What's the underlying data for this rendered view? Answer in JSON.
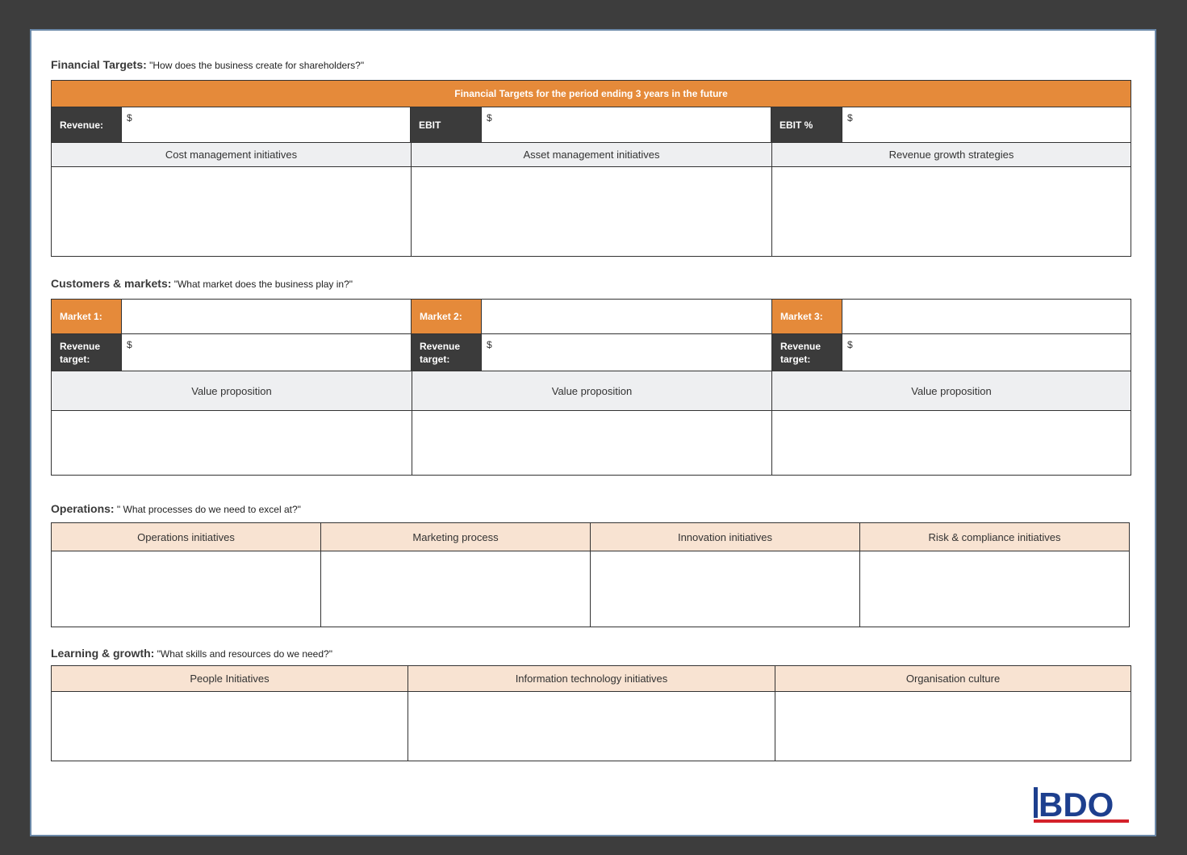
{
  "financial": {
    "title_bold": "Financial Targets:",
    "title_rest": " \"How does the business create for shareholders?\"",
    "header": "Financial Targets for the period ending 3 years in the future",
    "revenue_label": "Revenue:",
    "revenue_value": "$",
    "ebit_label": "EBIT",
    "ebit_value": "$",
    "ebit_pct_label": "EBIT %",
    "ebit_pct_value": "$",
    "columns": [
      "Cost management initiatives",
      "Asset management initiatives",
      "Revenue growth strategies"
    ]
  },
  "customers": {
    "title_bold": "Customers & markets:",
    "title_rest": " \"What market does the business play in?\"",
    "markets": [
      {
        "label": "Market 1:",
        "revenue_label": "Revenue target:",
        "revenue_value": "$",
        "value_prop": "Value proposition"
      },
      {
        "label": "Market 2:",
        "revenue_label": "Revenue target:",
        "revenue_value": "$",
        "value_prop": "Value proposition"
      },
      {
        "label": "Market 3:",
        "revenue_label": "Revenue target:",
        "revenue_value": "$",
        "value_prop": "Value proposition"
      }
    ]
  },
  "operations": {
    "title_bold": "Operations:",
    "title_rest": " \" What processes do we need to excel at?\"",
    "columns": [
      "Operations initiatives",
      "Marketing process",
      "Innovation initiatives",
      "Risk & compliance initiatives"
    ]
  },
  "learning": {
    "title_bold": "Learning & growth:",
    "title_rest": " \"What skills and resources do we need?\"",
    "columns": [
      "People Initiatives",
      "Information technology initiatives",
      "Organisation culture"
    ]
  },
  "logo": {
    "text": "BDO",
    "blue": "#1d3f8e",
    "red": "#d4212a"
  },
  "colors": {
    "orange": "#e58a3a",
    "dark": "#3b3b3b",
    "peach": "#f8e3d2",
    "grey": "#eeeff1",
    "frame": "#3d3d3d"
  }
}
